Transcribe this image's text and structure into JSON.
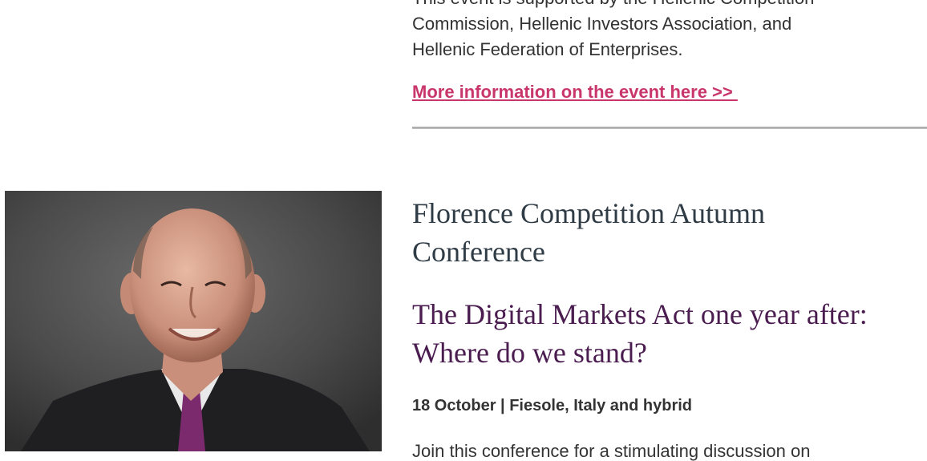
{
  "previous_event": {
    "support_lines": [
      "This event is supported by the Hellenic Competition",
      "Commission, Hellenic Investors Association, and",
      "Hellenic Federation of Enterprises."
    ],
    "more_link": "More information on the event here >> "
  },
  "event": {
    "photo_alt": "Portrait photo",
    "title": "Florence Competition Autumn Conference",
    "subtitle": "The Digital Markets Act one year after: Where do we stand?",
    "date_location": "18 October | Fiesole, Italy and hybrid",
    "description": "Join this conference for a stimulating discussion on"
  },
  "colors": {
    "link": "#c8366b",
    "subtitle": "#4a1c4f",
    "title": "#2f3b45",
    "body": "#333333"
  }
}
